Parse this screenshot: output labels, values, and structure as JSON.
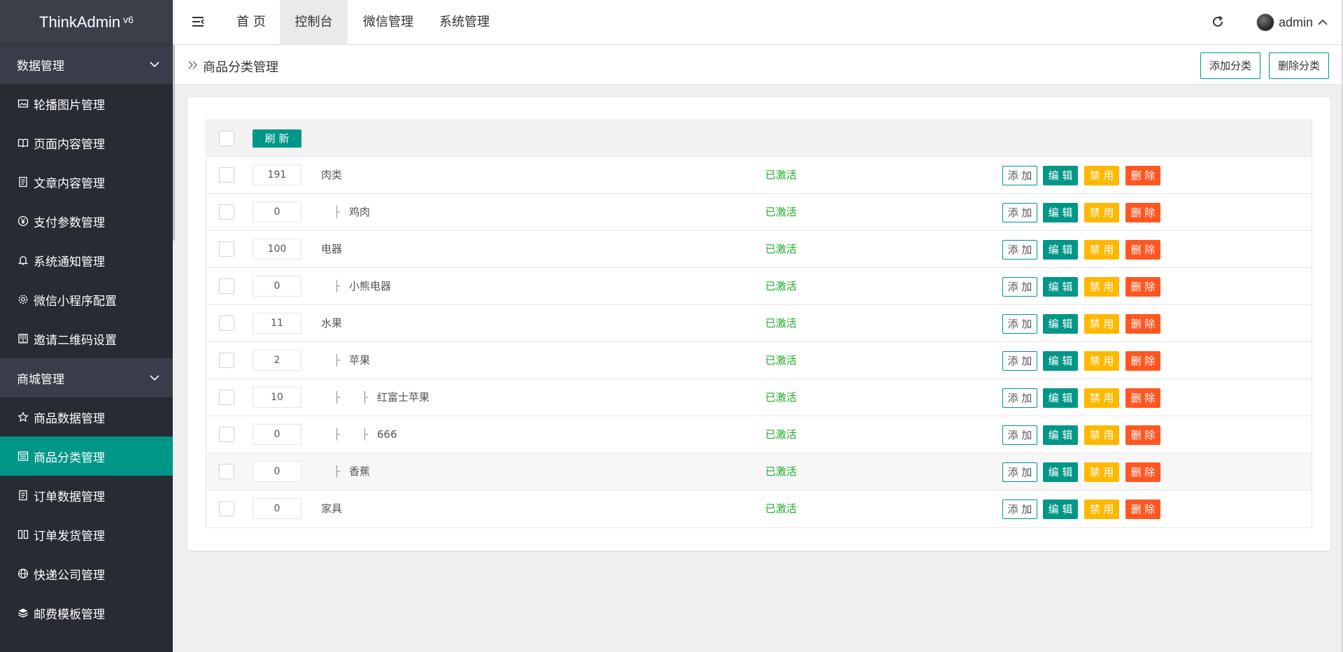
{
  "app": {
    "name": "ThinkAdmin",
    "version": "v6"
  },
  "sidebar": {
    "groups": [
      {
        "label": "数据管理",
        "items": [
          {
            "label": "轮播图片管理",
            "icon": "image-icon"
          },
          {
            "label": "页面内容管理",
            "icon": "book-icon"
          },
          {
            "label": "文章内容管理",
            "icon": "article-icon"
          },
          {
            "label": "支付参数管理",
            "icon": "yen-icon"
          },
          {
            "label": "系统通知管理",
            "icon": "bell-icon"
          },
          {
            "label": "微信小程序配置",
            "icon": "gear-icon"
          },
          {
            "label": "邀请二维码设置",
            "icon": "qrcode-icon"
          }
        ]
      },
      {
        "label": "商城管理",
        "items": [
          {
            "label": "商品数据管理",
            "icon": "star-icon"
          },
          {
            "label": "商品分类管理",
            "icon": "list-icon",
            "active": true
          },
          {
            "label": "订单数据管理",
            "icon": "article-icon"
          },
          {
            "label": "订单发货管理",
            "icon": "columns-icon"
          },
          {
            "label": "快递公司管理",
            "icon": "globe-icon"
          },
          {
            "label": "邮费模板管理",
            "icon": "layers-icon"
          }
        ]
      }
    ]
  },
  "header": {
    "tabs": [
      "首 页",
      "控制台",
      "微信管理",
      "系统管理"
    ],
    "active_tab": "控制台",
    "user": "admin"
  },
  "page": {
    "title": "商品分类管理",
    "add_button": "添加分类",
    "delete_button": "删除分类"
  },
  "table": {
    "refresh_label": "刷 新",
    "action_labels": {
      "add": "添 加",
      "edit": "编 辑",
      "disable": "禁 用",
      "delete": "删 除"
    },
    "rows": [
      {
        "sort": "191",
        "name": "肉类",
        "level": 0,
        "status": "已激活"
      },
      {
        "sort": "0",
        "name": "鸡肉",
        "level": 1,
        "status": "已激活"
      },
      {
        "sort": "100",
        "name": "电器",
        "level": 0,
        "status": "已激活"
      },
      {
        "sort": "0",
        "name": "小熊电器",
        "level": 1,
        "status": "已激活"
      },
      {
        "sort": "11",
        "name": "水果",
        "level": 0,
        "status": "已激活"
      },
      {
        "sort": "2",
        "name": "苹果",
        "level": 1,
        "status": "已激活"
      },
      {
        "sort": "10",
        "name": "红富士苹果",
        "level": 2,
        "status": "已激活"
      },
      {
        "sort": "0",
        "name": "666",
        "level": 2,
        "status": "已激活"
      },
      {
        "sort": "0",
        "name": "香蕉",
        "level": 1,
        "status": "已激活"
      },
      {
        "sort": "0",
        "name": "家具",
        "level": 0,
        "status": "已激活"
      }
    ],
    "tree_glyph": "├"
  },
  "colors": {
    "sidebar_bg": "#282b33",
    "sidebar_group_bg": "#393d49",
    "accent": "#009688",
    "warning": "#ffb800",
    "danger": "#ff5722",
    "status_green": "#1bad23"
  }
}
